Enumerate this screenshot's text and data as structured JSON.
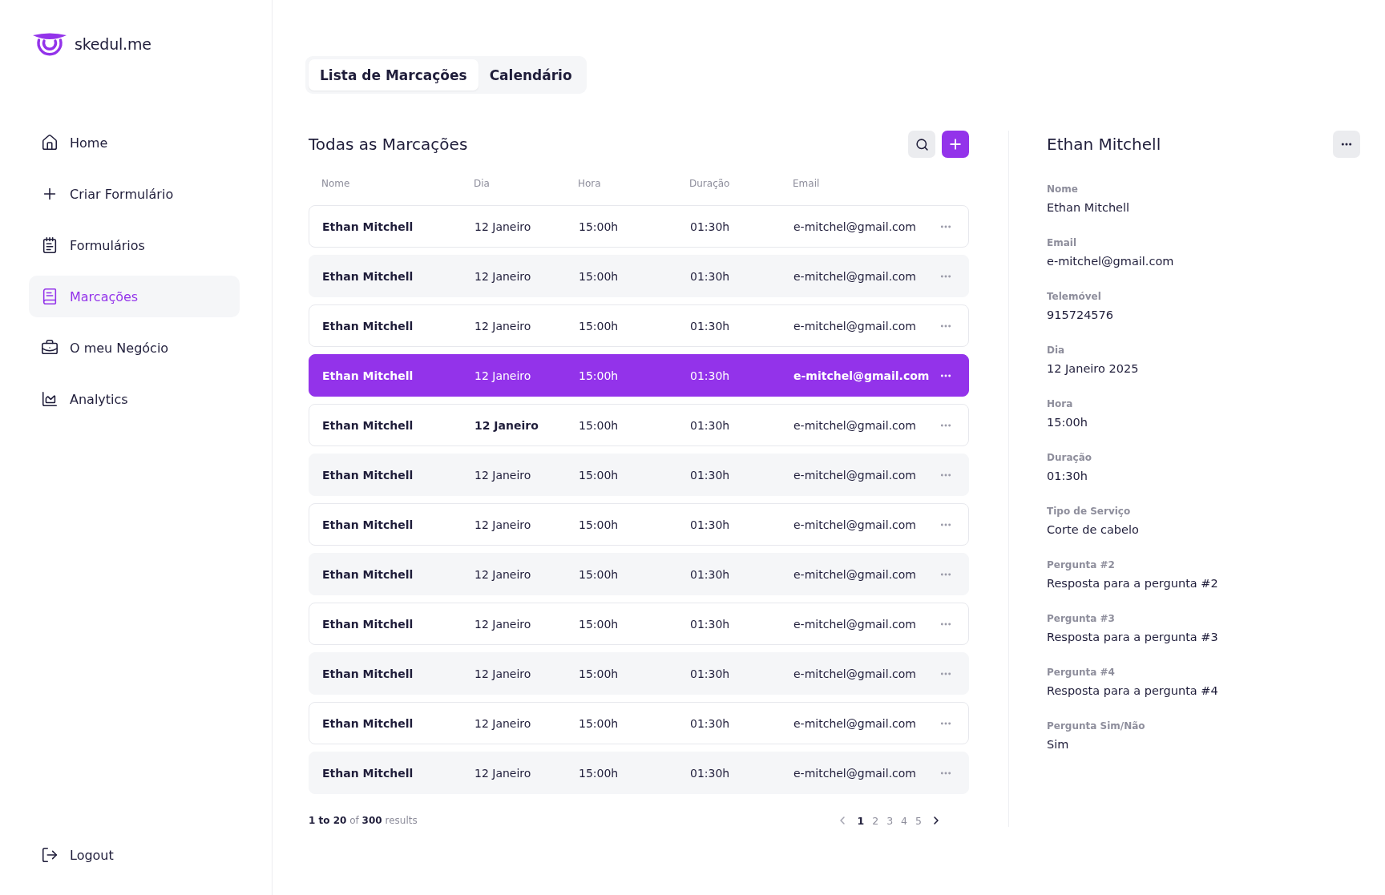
{
  "sidebar": {
    "logo": "skedul.me",
    "items": [
      {
        "label": "Home",
        "selected": false
      },
      {
        "label": "Criar Formulário",
        "selected": false
      },
      {
        "label": "Formulários",
        "selected": false
      },
      {
        "label": "Marcações",
        "selected": true
      },
      {
        "label": "O meu Negócio",
        "selected": false
      },
      {
        "label": "Analytics",
        "selected": false
      }
    ],
    "logout": "Logout"
  },
  "tabs": [
    {
      "label": "Lista de Marcações",
      "selected": true
    },
    {
      "label": "Calendário",
      "selected": false
    }
  ],
  "list": {
    "title": "Todas as Marcações",
    "columns": [
      "Nome",
      "Dia",
      "Hora",
      "Duração",
      "Email"
    ],
    "rows": [
      {
        "name": "Ethan Mitchell",
        "day": "12 Janeiro",
        "time": "15:00h",
        "duration": "01:30h",
        "email": "e-mitchel@gmail.com",
        "selected": false,
        "day_emphasized": false
      },
      {
        "name": "Ethan Mitchell",
        "day": "12 Janeiro",
        "time": "15:00h",
        "duration": "01:30h",
        "email": "e-mitchel@gmail.com",
        "selected": false,
        "day_emphasized": false
      },
      {
        "name": "Ethan Mitchell",
        "day": "12 Janeiro",
        "time": "15:00h",
        "duration": "01:30h",
        "email": "e-mitchel@gmail.com",
        "selected": false,
        "day_emphasized": false
      },
      {
        "name": "Ethan Mitchell",
        "day": "12 Janeiro",
        "time": "15:00h",
        "duration": "01:30h",
        "email": "e-mitchel@gmail.com",
        "selected": true,
        "day_emphasized": false
      },
      {
        "name": "Ethan Mitchell",
        "day": "12 Janeiro",
        "time": "15:00h",
        "duration": "01:30h",
        "email": "e-mitchel@gmail.com",
        "selected": false,
        "day_emphasized": true
      },
      {
        "name": "Ethan Mitchell",
        "day": "12 Janeiro",
        "time": "15:00h",
        "duration": "01:30h",
        "email": "e-mitchel@gmail.com",
        "selected": false,
        "day_emphasized": false
      },
      {
        "name": "Ethan Mitchell",
        "day": "12 Janeiro",
        "time": "15:00h",
        "duration": "01:30h",
        "email": "e-mitchel@gmail.com",
        "selected": false,
        "day_emphasized": false
      },
      {
        "name": "Ethan Mitchell",
        "day": "12 Janeiro",
        "time": "15:00h",
        "duration": "01:30h",
        "email": "e-mitchel@gmail.com",
        "selected": false,
        "day_emphasized": false
      },
      {
        "name": "Ethan Mitchell",
        "day": "12 Janeiro",
        "time": "15:00h",
        "duration": "01:30h",
        "email": "e-mitchel@gmail.com",
        "selected": false,
        "day_emphasized": false
      },
      {
        "name": "Ethan Mitchell",
        "day": "12 Janeiro",
        "time": "15:00h",
        "duration": "01:30h",
        "email": "e-mitchel@gmail.com",
        "selected": false,
        "day_emphasized": false
      },
      {
        "name": "Ethan Mitchell",
        "day": "12 Janeiro",
        "time": "15:00h",
        "duration": "01:30h",
        "email": "e-mitchel@gmail.com",
        "selected": false,
        "day_emphasized": false
      },
      {
        "name": "Ethan Mitchell",
        "day": "12 Janeiro",
        "time": "15:00h",
        "duration": "01:30h",
        "email": "e-mitchel@gmail.com",
        "selected": false,
        "day_emphasized": false
      }
    ],
    "pagination": {
      "summary": "**1 to 20** of **300** results",
      "prev_disabled": true,
      "next_disabled": false,
      "pages": [
        {
          "label": "1",
          "selected": true
        },
        {
          "label": "2",
          "selected": false
        },
        {
          "label": "3",
          "selected": false
        },
        {
          "label": "4",
          "selected": false
        },
        {
          "label": "5",
          "selected": false
        }
      ]
    }
  },
  "details": {
    "title": "Ethan Mitchell",
    "fields": [
      {
        "label": "Nome",
        "value": "Ethan Mitchell"
      },
      {
        "label": "Email",
        "value": "e-mitchel@gmail.com"
      },
      {
        "label": "Telemóvel",
        "value": "915724576"
      },
      {
        "label": "Dia",
        "value": "12 Janeiro 2025"
      },
      {
        "label": "Hora",
        "value": "15:00h"
      },
      {
        "label": "Duração",
        "value": "01:30h"
      },
      {
        "label": "Tipo de Serviço",
        "value": "Corte de cabelo"
      },
      {
        "label": "Pergunta #2",
        "value": "Resposta para a pergunta #2"
      },
      {
        "label": "Pergunta #3",
        "value": "Resposta para a pergunta #3"
      },
      {
        "label": "Pergunta #4",
        "value": "Resposta para a pergunta #4"
      },
      {
        "label": "Pergunta Sim/Não",
        "value": "Sim"
      }
    ]
  }
}
